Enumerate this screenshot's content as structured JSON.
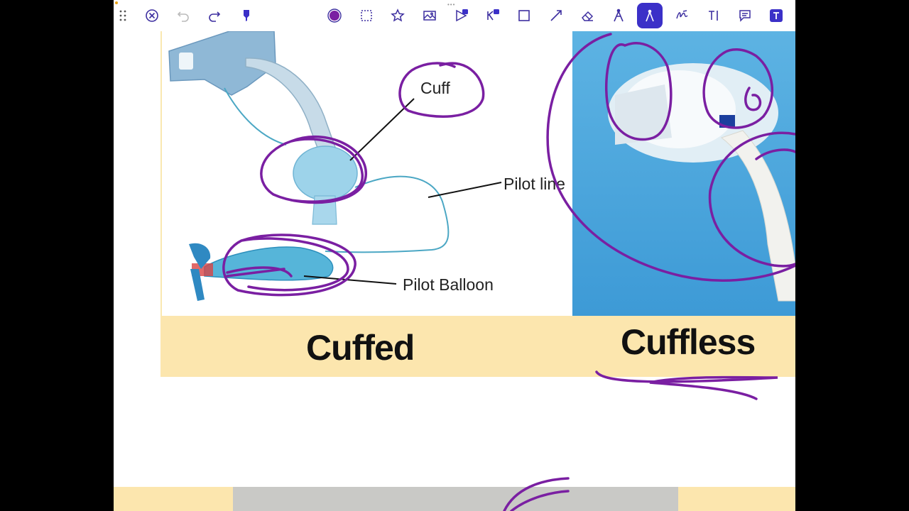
{
  "toolbar": {
    "tools": [
      {
        "name": "drag-handle-icon"
      },
      {
        "name": "close-icon"
      },
      {
        "name": "undo-icon"
      },
      {
        "name": "redo-icon"
      },
      {
        "name": "highlighter-icon"
      },
      {
        "name": "color-picker-icon"
      },
      {
        "name": "lasso-select-icon"
      },
      {
        "name": "star-icon"
      },
      {
        "name": "image-icon"
      },
      {
        "name": "presentation-icon"
      },
      {
        "name": "keynote-icon"
      },
      {
        "name": "shape-icon"
      },
      {
        "name": "line-icon"
      },
      {
        "name": "eraser-icon"
      },
      {
        "name": "pen-icon"
      },
      {
        "name": "laser-pointer-icon"
      },
      {
        "name": "signature-icon"
      },
      {
        "name": "text-tool-icon"
      },
      {
        "name": "comment-icon"
      },
      {
        "name": "text-box-icon"
      }
    ],
    "active_tool": "laser-pointer-icon",
    "ink_color": "#7a1fa2"
  },
  "slide": {
    "callouts": {
      "cuff": "Cuff",
      "pilot_line": "Pilot line",
      "pilot_balloon": "Pilot Balloon"
    },
    "labels": {
      "cuffed": "Cuffed",
      "cuffless": "Cuffless"
    },
    "band_color": "#fce6ae"
  },
  "annotation_color": "#7a1fa2"
}
